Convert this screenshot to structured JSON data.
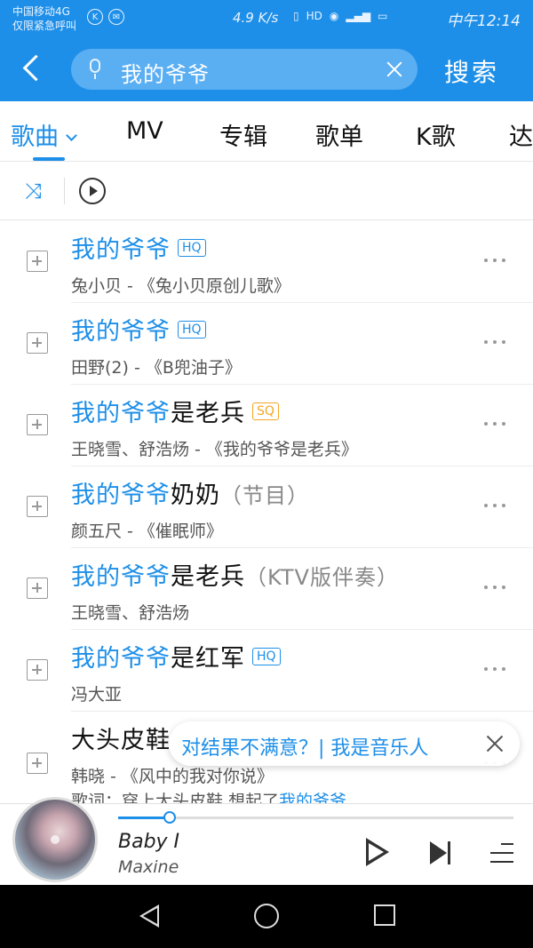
{
  "status_bar": {
    "carrier_line1": "中国移动4G",
    "carrier_line2": "仅限紧急呼叫",
    "speed": "4.9 K/s",
    "time": "中午12:14"
  },
  "header": {
    "search_value": "我的爷爷",
    "search_button": "搜索"
  },
  "tabs": [
    {
      "label": "歌曲",
      "active": true
    },
    {
      "label": "MV"
    },
    {
      "label": "专辑"
    },
    {
      "label": "歌单"
    },
    {
      "label": "K歌"
    },
    {
      "label": "达"
    }
  ],
  "toolbar": {
    "shuffle_icon": "shuffle-icon",
    "play_all_icon": "play-circle-icon"
  },
  "results": [
    {
      "title_hl": "我的爷爷",
      "title_rest": "",
      "title_extra": "",
      "badge": "HQ",
      "subtitle": "兔小贝 - 《兔小贝原创儿歌》"
    },
    {
      "title_hl": "我的爷爷",
      "title_rest": "",
      "title_extra": "",
      "badge": "HQ",
      "subtitle": "田野(2) - 《B兜油子》"
    },
    {
      "title_hl": "我的爷爷",
      "title_rest": "是老兵",
      "title_extra": "",
      "badge": "SQ",
      "subtitle": "王晓雪、舒浩炀 - 《我的爷爷是老兵》"
    },
    {
      "title_hl": "我的爷爷",
      "title_rest": "奶奶",
      "title_extra": "（节目）",
      "badge": "",
      "subtitle": "颜五尺 - 《催眠师》"
    },
    {
      "title_hl": "我的爷爷",
      "title_rest": "是老兵",
      "title_extra": "（KTV版伴奏）",
      "badge": "",
      "subtitle": "王晓雪、舒浩炀"
    },
    {
      "title_hl": "我的爷爷",
      "title_rest": "是红军",
      "title_extra": "",
      "badge": "HQ",
      "subtitle": "冯大亚"
    },
    {
      "title_hl": "",
      "title_rest": "大头皮鞋",
      "title_extra": "",
      "badge": "",
      "subtitle": "韩晓 - 《风中的我对你说》",
      "lyric_prefix": "歌词：穿上大头皮鞋 想起了",
      "lyric_hl": "我的爷爷"
    }
  ],
  "toast": {
    "text": "对结果不满意？| 我是音乐人"
  },
  "player": {
    "song": "Baby I",
    "artist": "Maxine",
    "progress": 0.13
  },
  "colors": {
    "accent": "#1e8fe8",
    "sq_badge": "#f5a623"
  }
}
